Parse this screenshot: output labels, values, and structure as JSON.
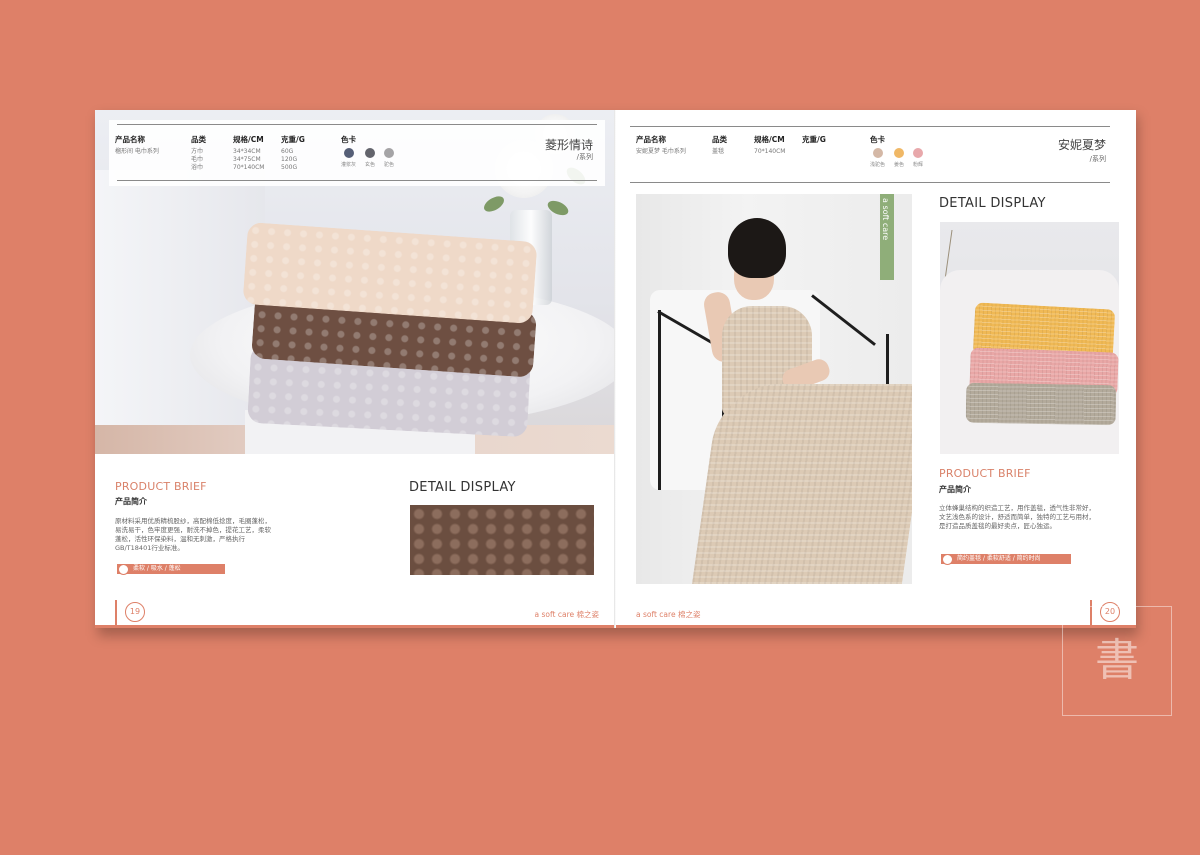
{
  "left_page": {
    "spec": {
      "headers": {
        "name": "产品名称",
        "category": "品类",
        "size": "规格/CM",
        "weight": "克重/G",
        "color": "色卡"
      },
      "name_value": "榴形间 电巾系列",
      "categories": [
        "方巾",
        "毛巾",
        "浴巾"
      ],
      "sizes": [
        "34*34CM",
        "34*75CM",
        "70*140CM"
      ],
      "weights": [
        "60G",
        "120G",
        "500G"
      ],
      "swatches": [
        {
          "label": "灌浆灰",
          "color": "#565f77"
        },
        {
          "label": "玄色",
          "color": "#63646c"
        },
        {
          "label": "驼色",
          "color": "#a5a4a6"
        }
      ]
    },
    "series_title": "菱形情诗",
    "series_sub": "/系列",
    "brief_title": "PRODUCT BRIEF",
    "brief_sub": "产品简介",
    "brief_lines": [
      "原材料采用优质精梳股纱，高配棉低捻度，毛圈蓬松，",
      "易洗易干，色牢度更强，耐洗不掉色，提花工艺，柔软",
      "蓬松，活性环保染料，温和无刺激，严格执行",
      "GB/T18401行业标准。"
    ],
    "tag": "柔软 / 吸水 / 蓬松",
    "detail_title": "DETAIL DISPLAY",
    "page_number": "19",
    "brand_footer": "a soft care 棉之姿"
  },
  "right_page": {
    "spec": {
      "headers": {
        "name": "产品名称",
        "category": "品类",
        "size": "规格/CM",
        "weight": "克重/G",
        "color": "色卡"
      },
      "name_value": "安妮夏梦 毛巾系列",
      "category_value": "盖毯",
      "size_value": "70*140CM",
      "swatches": [
        {
          "label": "浅驼色",
          "color": "#d4b8a6"
        },
        {
          "label": "姜色",
          "color": "#f0b866"
        },
        {
          "label": "粉辉",
          "color": "#e8a8ab"
        }
      ]
    },
    "series_title": "安妮夏梦",
    "series_sub": "/系列",
    "vertical_tab": "a soft care",
    "detail_title": "DETAIL DISPLAY",
    "brief_title": "PRODUCT BRIEF",
    "brief_sub": "产品简介",
    "brief_lines": [
      "立体蜂巢结构的织造工艺，用作盖毯，透气性非常好，",
      "文艺浅色系的设计，舒适而简单，独特的工艺与用材，",
      "是打造品质盖毯的最好卖点，匠心独运。"
    ],
    "tag": "简约盖毯 / 柔软舒适 / 简约时尚",
    "page_number": "20",
    "brand_footer": "a soft care 棉之姿"
  },
  "colors": {
    "background": "#de8068",
    "accent": "#de8068",
    "tab_green": "#8fae79"
  }
}
